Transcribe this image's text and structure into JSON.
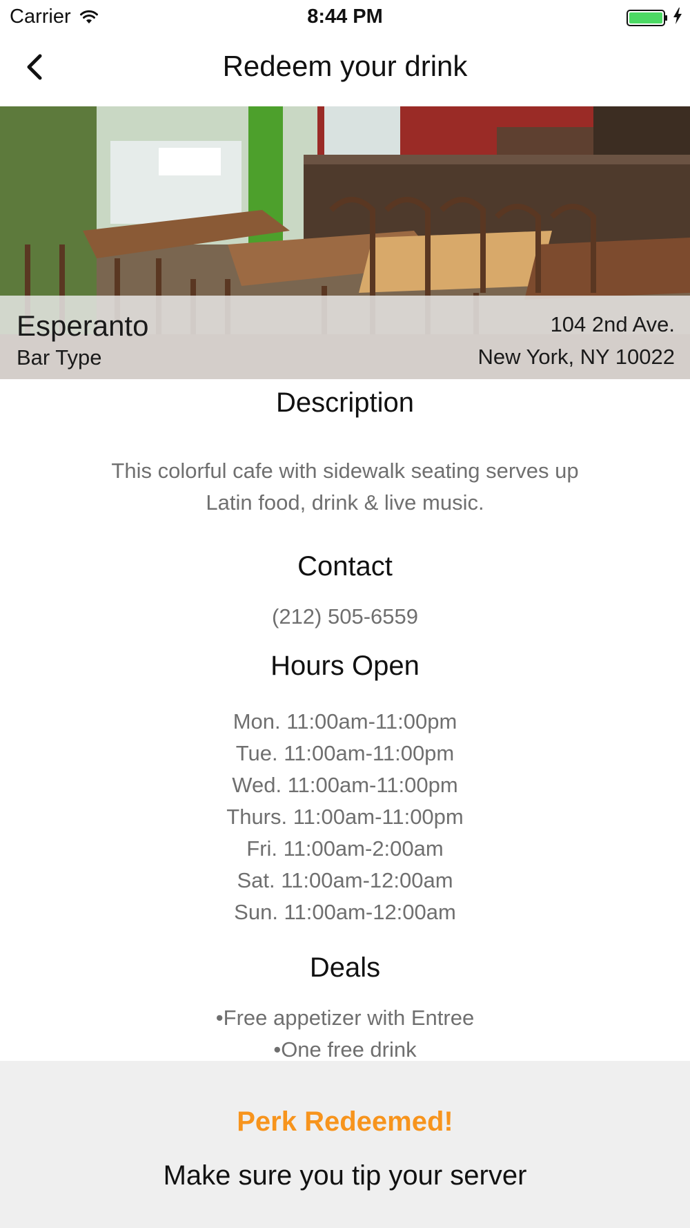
{
  "status_bar": {
    "carrier": "Carrier",
    "time": "8:44 PM",
    "icons": [
      "wifi-icon",
      "battery-icon",
      "charging-bolt-icon"
    ],
    "battery_color": "#4cd964"
  },
  "nav": {
    "title": "Redeem your drink",
    "back_icon": "chevron-left-icon"
  },
  "venue": {
    "name": "Esperanto",
    "type": "Bar Type",
    "address_line1": "104 2nd Ave.",
    "address_line2": "New York, NY 10022"
  },
  "description": {
    "title": "Description",
    "text": "This colorful cafe with sidewalk seating serves up Latin food, drink & live music."
  },
  "contact": {
    "title": "Contact",
    "phone": "(212) 505-6559"
  },
  "hours": {
    "title": "Hours Open",
    "items": [
      "Mon. 11:00am-11:00pm",
      "Tue. 11:00am-11:00pm",
      "Wed. 11:00am-11:00pm",
      "Thurs. 11:00am-11:00pm",
      "Fri. 11:00am-2:00am",
      "Sat. 11:00am-12:00am",
      "Sun. 11:00am-12:00am"
    ]
  },
  "deals": {
    "title": "Deals",
    "items": [
      "•Free appetizer with Entree",
      "•One free drink"
    ]
  },
  "redeem": {
    "title": "Perk Redeemed!",
    "message": "Make sure you tip your server",
    "accent_color": "#f7941d"
  }
}
